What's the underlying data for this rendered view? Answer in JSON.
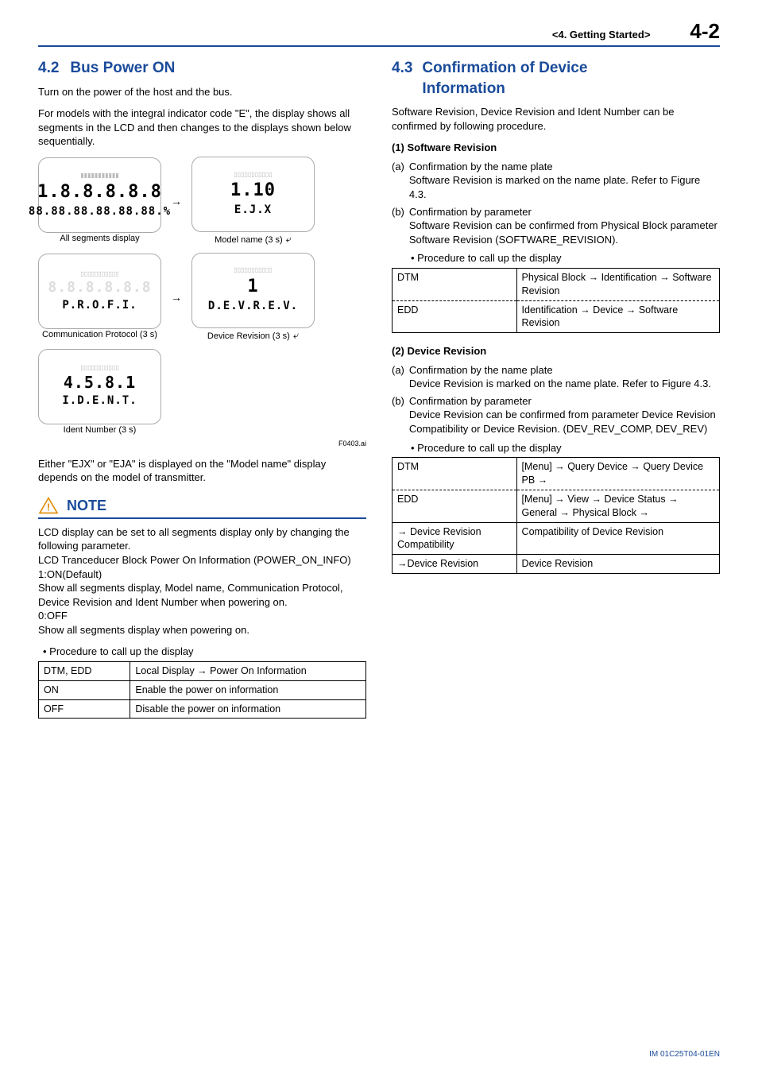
{
  "header": {
    "chapter": "<4.  Getting Started>",
    "page_number": "4-2"
  },
  "left": {
    "sec42": {
      "num": "4.2",
      "title": "Bus Power ON"
    },
    "p1": "Turn on the power of the host and the bus.",
    "p2": "For models with the integral indicator code \"E\", the display shows all segments in the LCD and then changes to the displays shown below sequentially.",
    "lcd": {
      "all_segments_big": "1.8.8.8.8.8",
      "all_segments_sub": "88.88.88.88.88.88.%",
      "all_segments_caption": "All segments display",
      "model_big": "1.10",
      "model_sub": "E.J.X",
      "model_caption": "Model name (3 s)",
      "profi_sub": "P.R.O.F.I.",
      "profi_caption": "Communication Protocol (3 s)",
      "devrev_big": "1",
      "devrev_sub": "D.E.V.R.E.V.",
      "devrev_caption": "Device Revision (3 s)",
      "ident_big": "4.5.8.1",
      "ident_sub": "I.D.E.N.T.",
      "ident_caption": "Ident Number (3 s)",
      "fig_id": "F0403.ai"
    },
    "p3": "Either \"EJX\" or \"EJA\" is displayed on the \"Model name\" display depends on the model of transmitter.",
    "note": {
      "title": "NOTE",
      "body1": "LCD display can be set to all segments display only by changing the following parameter.",
      "body2": "LCD Tranceducer Block Power On Information (POWER_ON_INFO)",
      "body3": "1:ON(Default)",
      "body4": "Show all segments display, Model name, Communication Protocol, Device Revision and Ident Number when powering on.",
      "body5": "0:OFF",
      "body6": "Show all segments display when powering on."
    },
    "proc_lead": "Procedure to call up the display",
    "table1": {
      "r1c1": "DTM, EDD",
      "r1c2": "Local Display → Power On Information",
      "r2c1": "ON",
      "r2c2": "Enable the power on information",
      "r3c1": "OFF",
      "r3c2": "Disable the power on information"
    }
  },
  "right": {
    "sec43": {
      "num": "4.3",
      "title_l1": "Confirmation of Device",
      "title_l2": "Information"
    },
    "p1": "Software Revision, Device Revision and Ident Number can be confirmed by following procedure.",
    "g1": {
      "head": "(1)   Software Revision",
      "a_lbl": "(a)",
      "a_title": "Confirmation by the name plate",
      "a_body": "Software Revision is marked on the name plate. Refer to Figure 4.3.",
      "b_lbl": "(b)",
      "b_title": "Confirmation by parameter",
      "b_body": "Software Revision can be confirmed from Physical Block parameter Software Revision (SOFTWARE_REVISION).",
      "proc_lead": "Procedure to call up the display",
      "t": {
        "r1c1": "DTM",
        "r1c2": "Physical Block → Identification → Software Revision",
        "r2c1": "EDD",
        "r2c2": "Identification → Device → Software Revision"
      }
    },
    "g2": {
      "head": "(2)   Device Revision",
      "a_lbl": "(a)",
      "a_title": "Confirmation by the name plate",
      "a_body": "Device Revision is marked on the name plate. Refer to Figure 4.3.",
      "b_lbl": "(b)",
      "b_title": "Confirmation by parameter",
      "b_body": "Device Revision can be confirmed from parameter Device Revision Compatibility or Device Revision. (DEV_REV_COMP, DEV_REV)",
      "proc_lead": "Procedure to call up the display",
      "t": {
        "r1c1": "DTM",
        "r1c2": "[Menu] → Query Device → Query Device PB →",
        "r2c1": "EDD",
        "r2c2": "[Menu] → View → Device Status → General → Physical Block →",
        "r3c1": "→ Device Revision Compatibility",
        "r3c2": "Compatibility of Device Revision",
        "r4c1": "→Device Revision",
        "r4c2": "Device Revision"
      }
    }
  },
  "footer": {
    "doc_id": "IM 01C25T04-01EN"
  }
}
